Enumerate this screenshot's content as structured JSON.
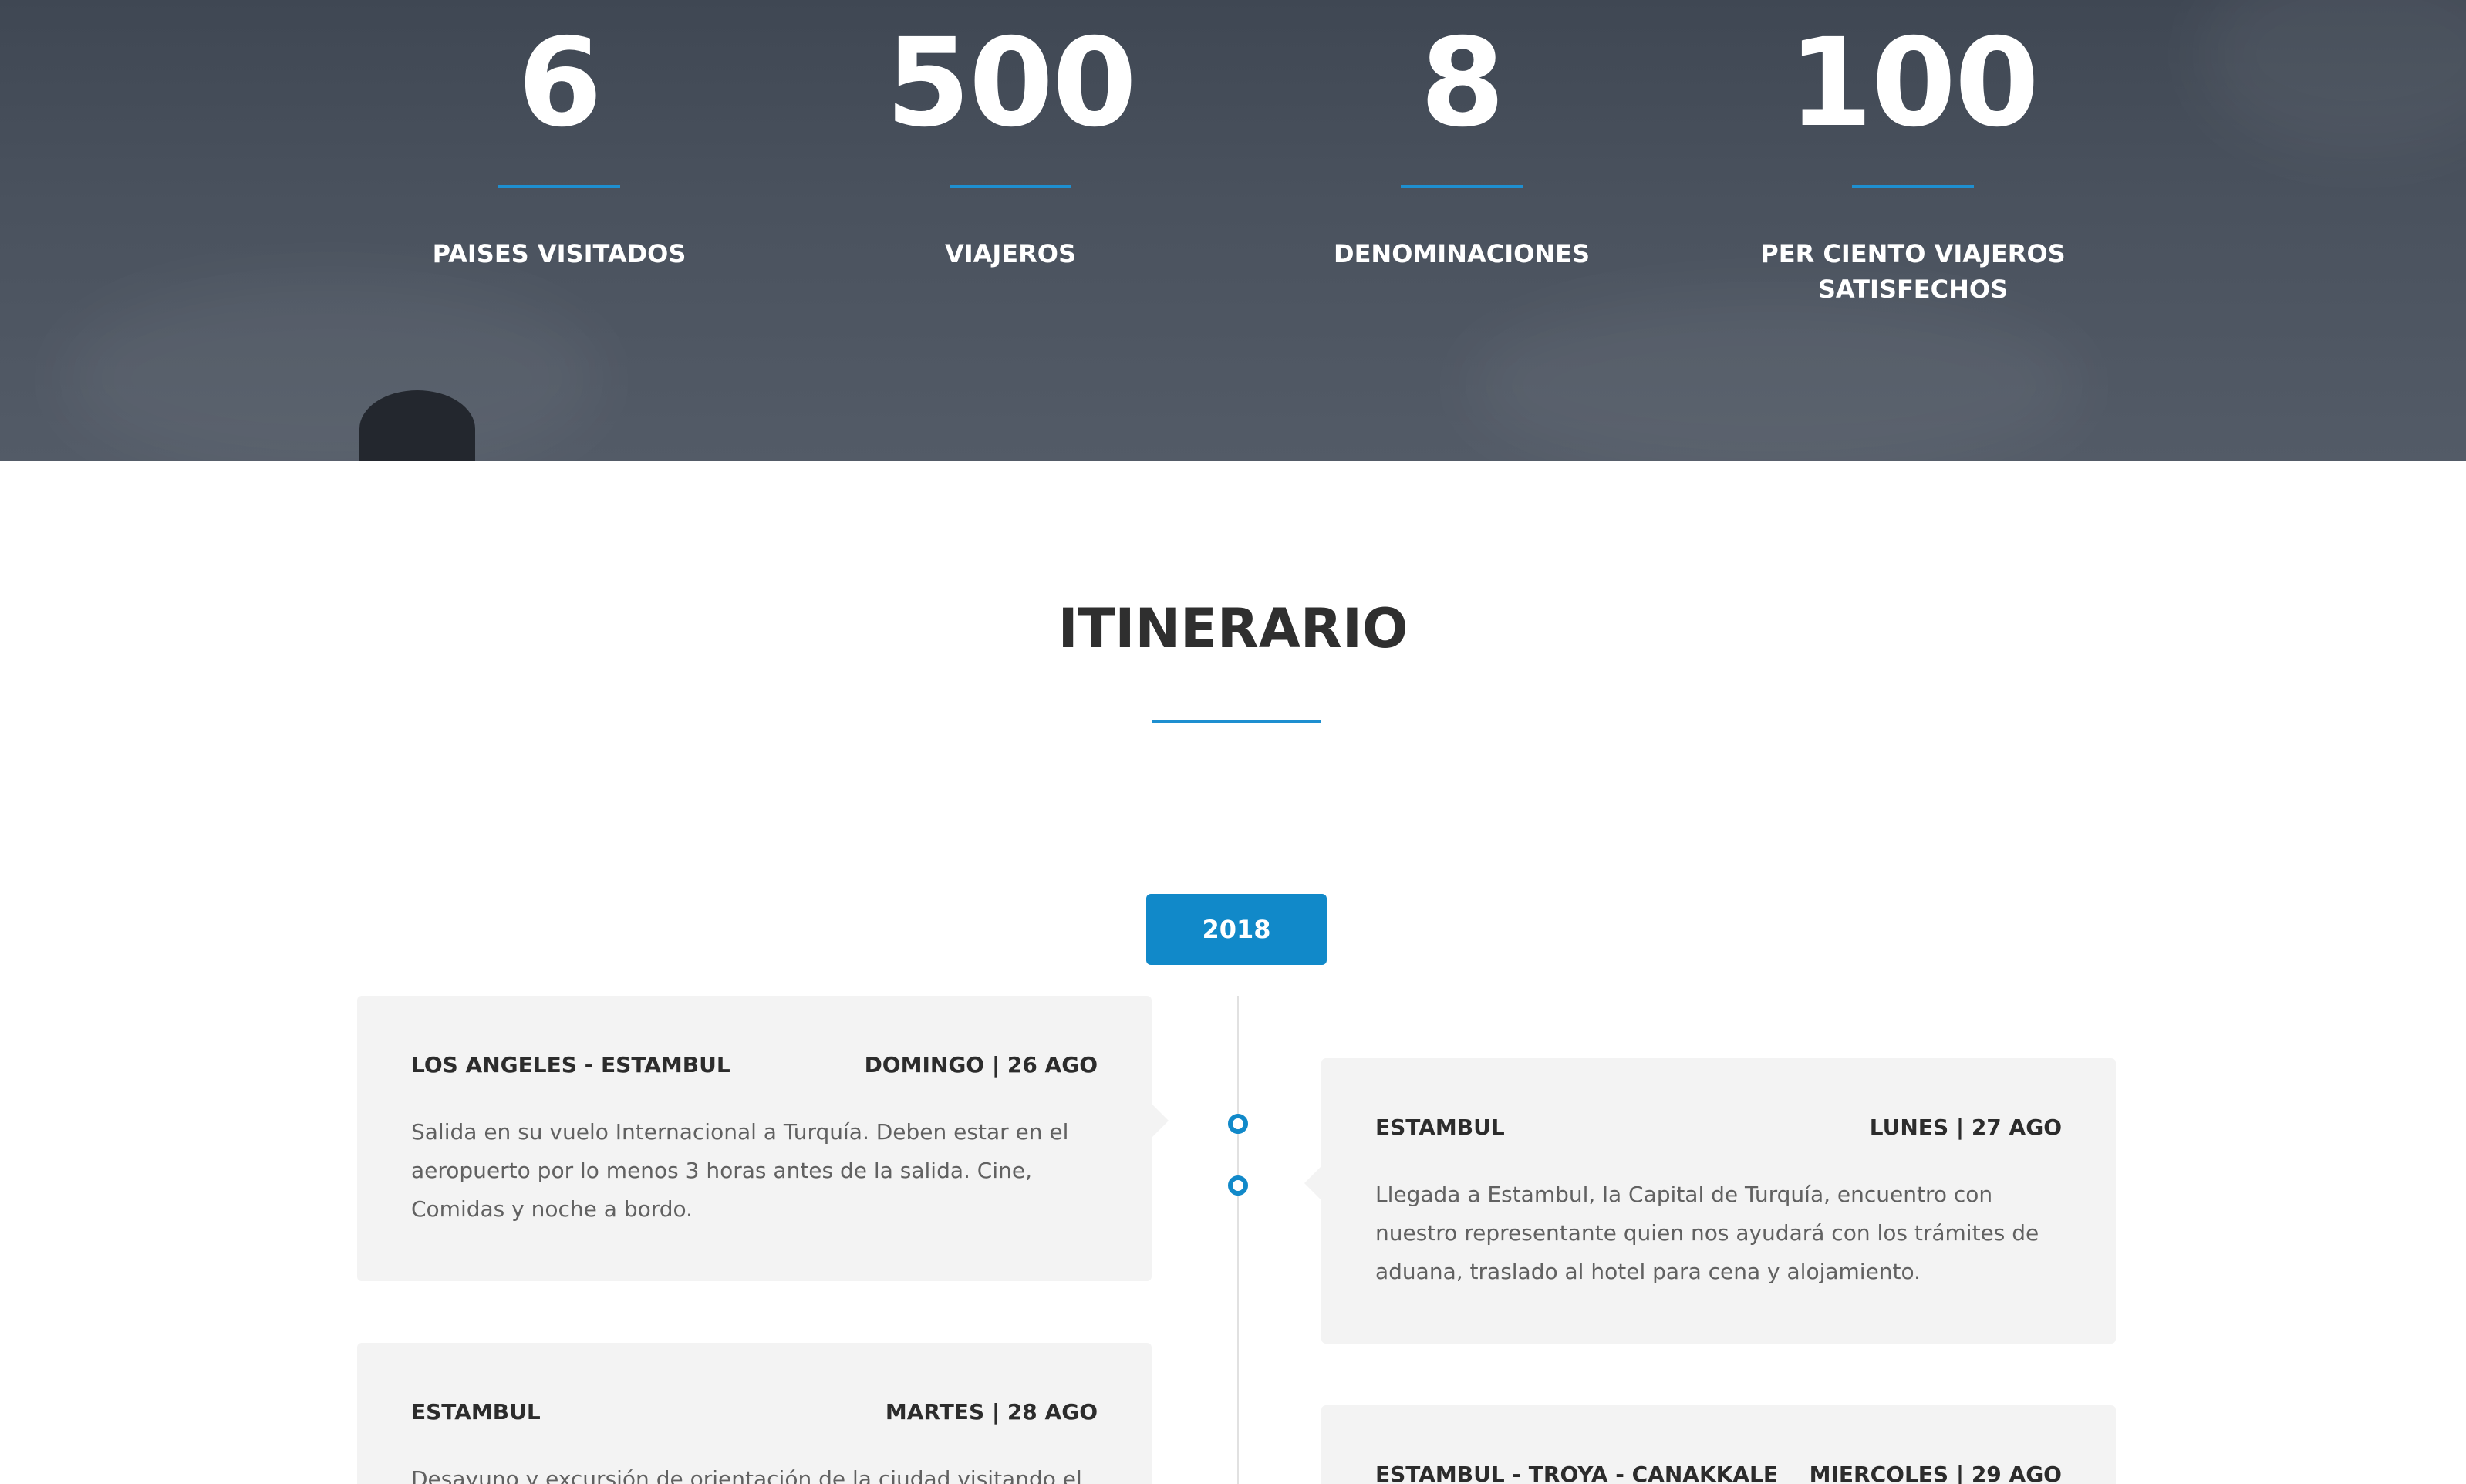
{
  "stats": [
    {
      "value": "6",
      "label": "PAISES VISITADOS"
    },
    {
      "value": "500",
      "label": "VIAJEROS"
    },
    {
      "value": "8",
      "label": "DENOMINACIONES"
    },
    {
      "value": "100",
      "label": "PER CIENTO VIAJEROS SATISFECHOS"
    }
  ],
  "itinerary": {
    "title": "ITINERARIO",
    "year": "2018",
    "entries": [
      {
        "place": "LOS ANGELES - ESTAMBUL",
        "date": "DOMINGO | 26 AGO",
        "text": "Salida en su vuelo Internacional a Turquía. Deben estar en el aeropuerto por lo menos 3 horas antes de la salida. Cine, Comidas y noche a bordo."
      },
      {
        "place": "ESTAMBUL",
        "date": "LUNES | 27 AGO",
        "text": "Llegada a Estambul, la Capital de Turquía, encuentro con nuestro representante quien nos ayudará con los trámites de aduana, traslado al hotel para cena y alojamiento."
      },
      {
        "place": "ESTAMBUL",
        "date": "MARTES | 28 AGO",
        "text": "Desayuno y excursión de orientación de la ciudad visitando el"
      },
      {
        "place": "ESTAMBUL - TROYA - CANAKKALE",
        "date": "MIERCOLES | 29 AGO",
        "text": ""
      }
    ]
  },
  "colors": {
    "accent": "#1189c9",
    "card_bg": "#f3f3f3",
    "hero_bg": "#4a525e"
  }
}
